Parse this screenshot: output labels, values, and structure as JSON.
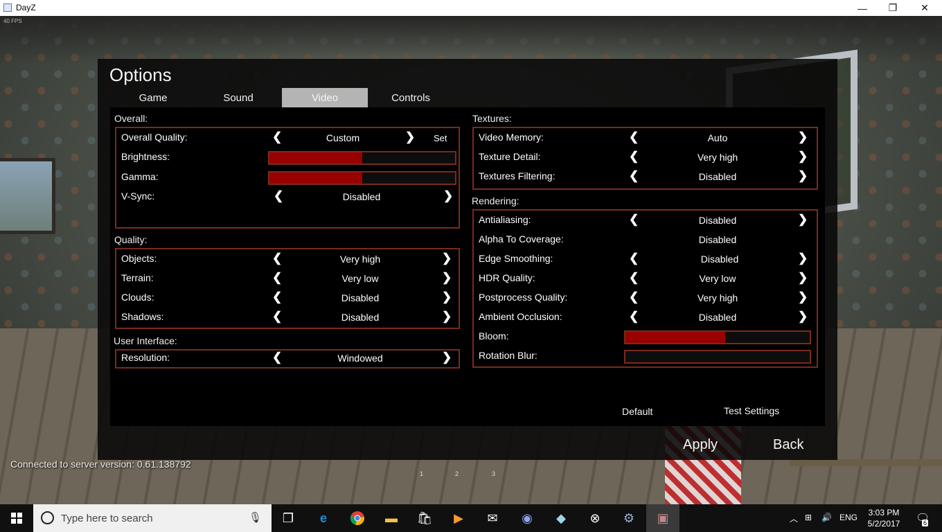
{
  "window": {
    "title": "DayZ",
    "minimize": "—",
    "maximize": "❐",
    "close": "✕"
  },
  "hud": {
    "fps": "40 FPS",
    "server_version": "Connected to server version: 0.61.138792",
    "pages": [
      "1",
      "2",
      "3"
    ]
  },
  "dialog": {
    "title": "Options",
    "tabs": [
      {
        "label": "Game"
      },
      {
        "label": "Sound"
      },
      {
        "label": "Video",
        "active": true
      },
      {
        "label": "Controls"
      }
    ],
    "overall": {
      "label": "Overall:",
      "quality": {
        "label": "Overall Quality:",
        "value": "Custom",
        "set": "Set"
      },
      "brightness": {
        "label": "Brightness:",
        "level": 0.5
      },
      "gamma": {
        "label": "Gamma:",
        "level": 0.5
      },
      "vsync": {
        "label": "V-Sync:",
        "value": "Disabled"
      }
    },
    "quality": {
      "label": "Quality:",
      "objects": {
        "label": "Objects:",
        "value": "Very high"
      },
      "terrain": {
        "label": "Terrain:",
        "value": "Very low"
      },
      "clouds": {
        "label": "Clouds:",
        "value": "Disabled"
      },
      "shadows": {
        "label": "Shadows:",
        "value": "Disabled"
      }
    },
    "ui": {
      "label": "User Interface:",
      "resolution": {
        "label": "Resolution:",
        "value": "Windowed"
      }
    },
    "textures": {
      "label": "Textures:",
      "video_memory": {
        "label": "Video Memory:",
        "value": "Auto"
      },
      "texture_detail": {
        "label": "Texture Detail:",
        "value": "Very high"
      },
      "filtering": {
        "label": "Textures Filtering:",
        "value": "Disabled"
      }
    },
    "rendering": {
      "label": "Rendering:",
      "antialiasing": {
        "label": "Antialiasing:",
        "value": "Disabled"
      },
      "alpha_coverage": {
        "label": "Alpha To Coverage:",
        "value": "Disabled"
      },
      "edge_smoothing": {
        "label": "Edge Smoothing:",
        "value": "Disabled"
      },
      "hdr": {
        "label": "HDR Quality:",
        "value": "Very low"
      },
      "postprocess": {
        "label": "Postprocess Quality:",
        "value": "Very high"
      },
      "ambient_occlusion": {
        "label": "Ambient Occlusion:",
        "value": "Disabled"
      },
      "bloom": {
        "label": "Bloom:",
        "level": 0.54
      },
      "rotation_blur": {
        "label": "Rotation Blur:",
        "level": 0
      }
    },
    "buttons": {
      "default": "Default",
      "test": "Test Settings",
      "apply": "Apply",
      "back": "Back"
    },
    "arrows": {
      "left": "❮",
      "right": "❯"
    }
  },
  "taskbar": {
    "search_placeholder": "Type here to search",
    "language": "ENG",
    "time": "3:03 PM",
    "date": "5/2/2017",
    "notification_count": "6",
    "accent": "#990000"
  }
}
